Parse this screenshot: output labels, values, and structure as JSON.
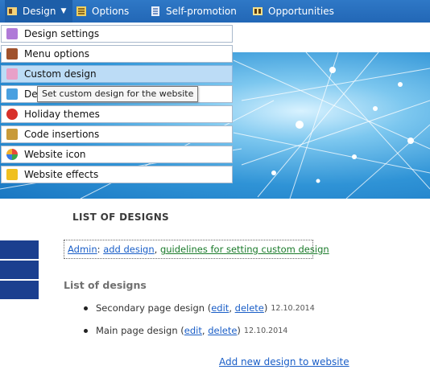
{
  "menubar": {
    "design": "Design",
    "options": "Options",
    "self_promotion": "Self-promotion",
    "opportunities": "Opportunities"
  },
  "dropdown": {
    "items": [
      {
        "label": "Design settings",
        "icon": "design-settings-icon",
        "color": "#b07ad8"
      },
      {
        "label": "Menu options",
        "icon": "menu-options-icon",
        "color": "#a0522d"
      },
      {
        "label": "Custom design",
        "icon": "custom-design-icon",
        "color": "#e8a0c8"
      },
      {
        "label": "De",
        "icon": "design-icon",
        "color": "#4aa0e0"
      },
      {
        "label": "Holiday themes",
        "icon": "holiday-themes-icon",
        "color": "#d8302a"
      },
      {
        "label": "Code insertions",
        "icon": "code-insertions-icon",
        "color": "#c89a3a"
      },
      {
        "label": "Website icon",
        "icon": "website-icon-icon",
        "color": "#f0a030"
      },
      {
        "label": "Website effects",
        "icon": "website-effects-icon",
        "color": "#f0c020"
      }
    ],
    "active_index": 2
  },
  "tooltip": "Set custom design for the website",
  "main": {
    "section_title": "LIST OF DESIGNS",
    "admin_label": "Admin",
    "admin_sep": ":",
    "add_design": "add design",
    "comma": ",",
    "guidelines": "guidelines for setting custom design",
    "list_title": "List of designs",
    "designs": [
      {
        "name": "Secondary page design (",
        "edit": "edit",
        "sep": ", ",
        "delete": "delete",
        "close": ")",
        "date": "12.10.2014"
      },
      {
        "name": "Main page design (",
        "edit": "edit",
        "sep": ", ",
        "delete": "delete",
        "close": ")",
        "date": "12.10.2014"
      }
    ],
    "add_new": "Add new design to website"
  },
  "colors": {
    "menubar": "#2267b6",
    "active_item": "#bcdcf6",
    "leftbar": "#1b3f8f",
    "link": "#1a5ec7",
    "green_link": "#1a7a2a"
  }
}
